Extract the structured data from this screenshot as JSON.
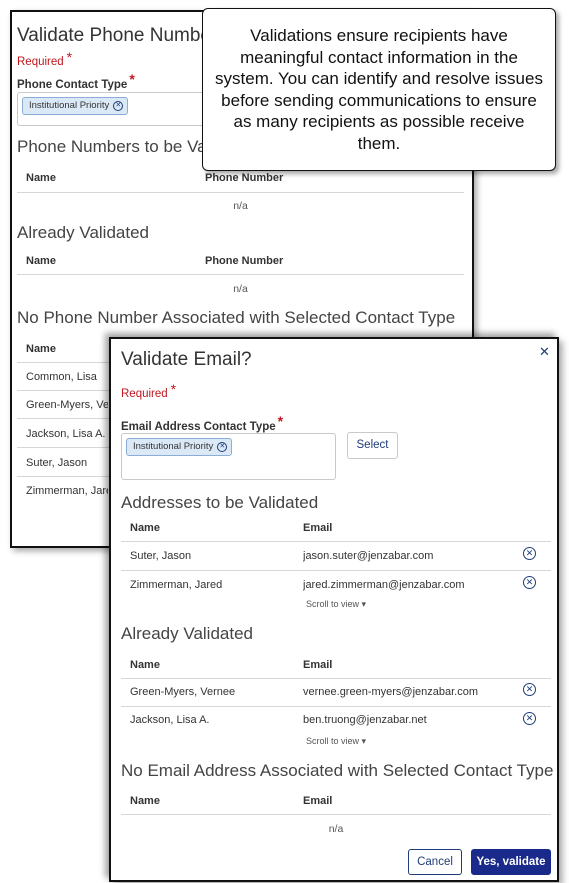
{
  "phone_dialog": {
    "title": "Validate Phone Numbers?",
    "required": "Required",
    "contact_type_label": "Phone Contact Type",
    "chip": "Institutional Priority",
    "section_to_validate": "Phone Numbers to be Validated",
    "section_already": "Already Validated",
    "section_none": "No Phone Number Associated with Selected Contact Type",
    "col_name": "Name",
    "col_phone": "Phone Number",
    "na": "n/a",
    "none_rows": [
      "Common, Lisa",
      "Green-Myers, Vernee",
      "Jackson, Lisa A.",
      "Suter, Jason",
      "Zimmerman, Jared"
    ]
  },
  "callout": {
    "text": "Validations ensure recipients have meaningful contact information in the system. You can identify and resolve issues before sending communications to ensure as many recipients as possible receive them."
  },
  "email_dialog": {
    "title": "Validate Email?",
    "required": "Required",
    "contact_type_label": "Email Address Contact Type",
    "chip": "Institutional Priority",
    "select_button": "Select",
    "section_to_validate": "Addresses to be Validated",
    "section_already": "Already Validated",
    "section_none": "No Email Address Associated with Selected Contact Type",
    "col_name": "Name",
    "col_email": "Email",
    "to_validate_rows": [
      {
        "name": "Suter, Jason",
        "email": "jason.suter@jenzabar.com"
      },
      {
        "name": "Zimmerman, Jared",
        "email": "jared.zimmerman@jenzabar.com"
      }
    ],
    "already_rows": [
      {
        "name": "Green-Myers, Vernee",
        "email": "vernee.green-myers@jenzabar.com"
      },
      {
        "name": "Jackson, Lisa A.",
        "email": "ben.truong@jenzabar.net"
      }
    ],
    "scroll_hint": "Scroll to view",
    "na": "n/a",
    "cancel_button": "Cancel",
    "confirm_button": "Yes, validate"
  },
  "icons": {
    "close": "close-icon",
    "remove": "remove-circle-icon",
    "caret": "caret-down-icon"
  },
  "colors": {
    "primary": "#1a2a8a",
    "required": "#c0171f",
    "chip_bg": "#dbe9f7"
  }
}
